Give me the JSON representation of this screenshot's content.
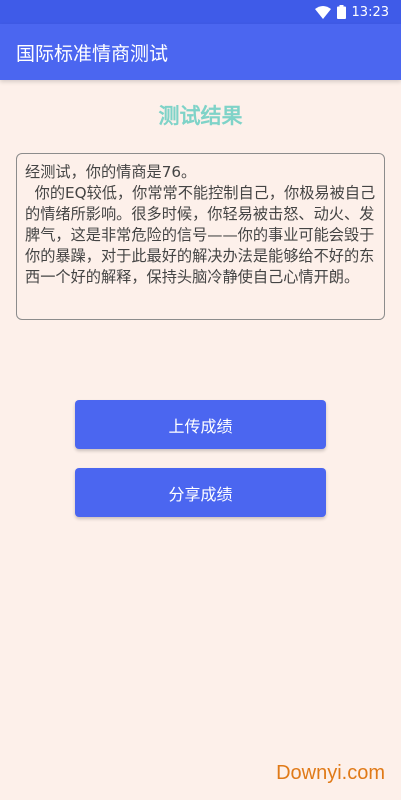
{
  "status_bar": {
    "time": "13:23",
    "wifi_icon": "wifi-icon",
    "battery_icon": "battery-icon"
  },
  "app_bar": {
    "title": "国际标准情商测试"
  },
  "result": {
    "title": "测试结果",
    "summary": "经测试，你的情商是76。",
    "description": "  你的EQ较低，你常常不能控制自己，你极易被自己的情绪所影响。很多时候，你轻易被击怒、动火、发脾气，这是非常危险的信号——你的事业可能会毁于你的暴躁，对于此最好的解决办法是能够给不好的东西一个好的解释，保持头脑冷静使自己心情开朗。"
  },
  "buttons": {
    "upload": "上传成绩",
    "share": "分享成绩"
  },
  "watermark": "Downyi.com",
  "colors": {
    "primary": "#4b66f0",
    "title_accent": "#7fd3c8",
    "background": "#fdf0ea",
    "watermark": "#e07a18"
  }
}
